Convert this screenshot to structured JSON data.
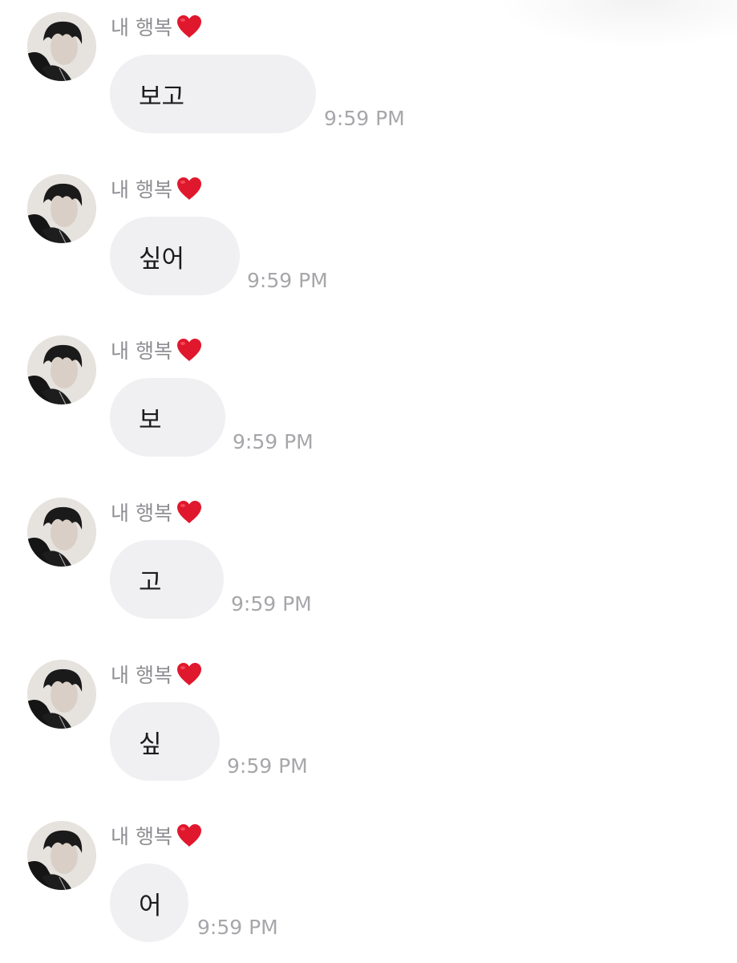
{
  "messages": [
    {
      "sender": "내 행복",
      "text": "보고",
      "time": "9:59 PM"
    },
    {
      "sender": "내 행복",
      "text": "싶어",
      "time": "9:59 PM"
    },
    {
      "sender": "내 행복",
      "text": "보",
      "time": "9:59 PM"
    },
    {
      "sender": "내 행복",
      "text": "고",
      "time": "9:59 PM"
    },
    {
      "sender": "내 행복",
      "text": "싶",
      "time": "9:59 PM"
    },
    {
      "sender": "내 행복",
      "text": "어",
      "time": "9:59 PM"
    }
  ],
  "icons": {
    "sender_emoji": "heart-icon",
    "avatar": "profile-photo"
  },
  "colors": {
    "bubble": "#f0f0f2",
    "sender_text": "#8e8e93",
    "time_text": "#a7a7ab",
    "heart": "#e0182d"
  }
}
